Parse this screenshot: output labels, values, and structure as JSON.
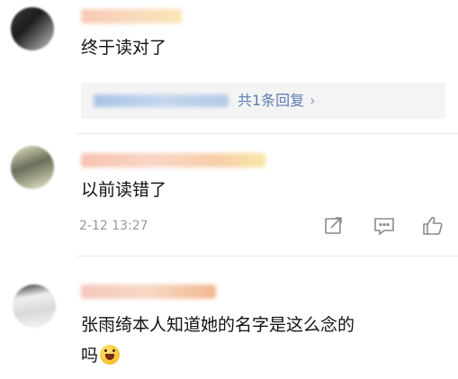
{
  "comments": [
    {
      "author_hidden": true,
      "text": "终于读对了",
      "reply_summary": {
        "label": "共1条回复",
        "chevron": "›"
      }
    },
    {
      "author_hidden": true,
      "text": "以前读错了",
      "date": "2-12 13:27",
      "actions": [
        "share-icon",
        "comment-icon",
        "like-icon"
      ]
    },
    {
      "author_hidden": true,
      "text_line1": "张雨绮本人知道她的名字是这么念的",
      "text_line2": "吗",
      "emoji": "laughing-emoji-icon"
    }
  ]
}
